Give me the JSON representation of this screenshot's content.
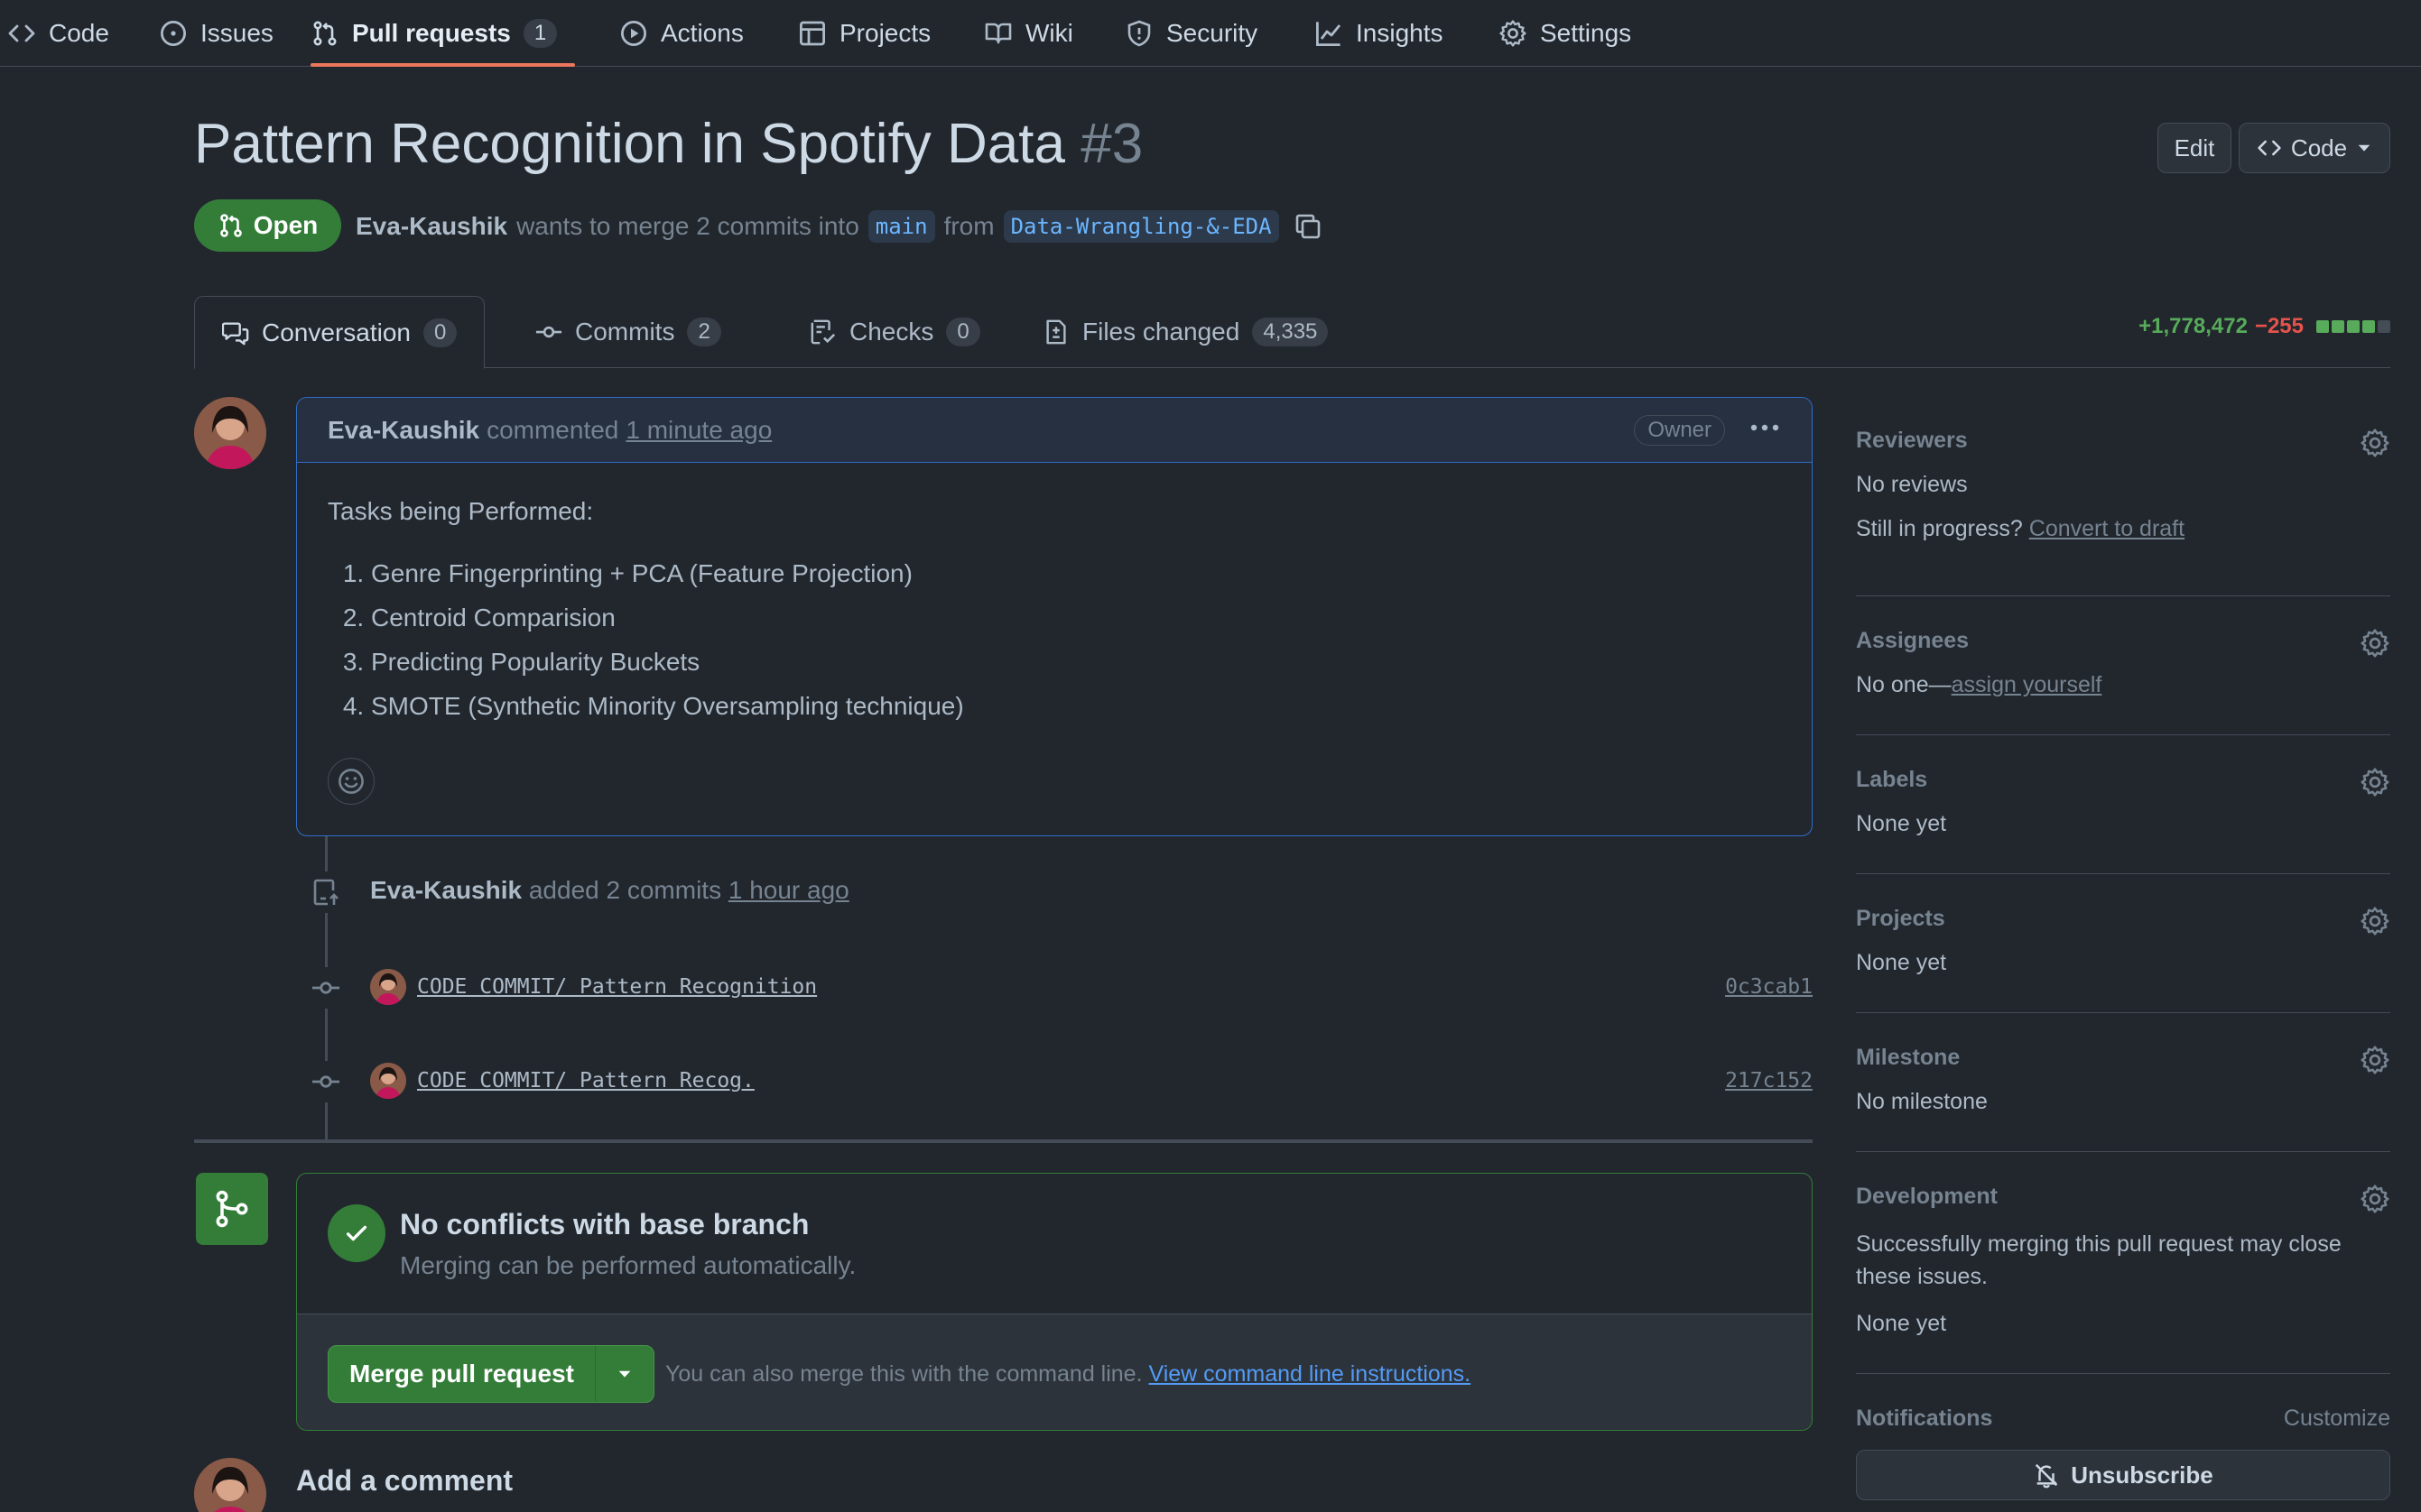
{
  "repo_nav": [
    {
      "label": "Code",
      "icon": "code-icon"
    },
    {
      "label": "Issues",
      "icon": "issue-opened-icon"
    },
    {
      "label": "Pull requests",
      "icon": "git-pull-request-icon",
      "count": "1",
      "active": true
    },
    {
      "label": "Actions",
      "icon": "play-icon"
    },
    {
      "label": "Projects",
      "icon": "table-icon"
    },
    {
      "label": "Wiki",
      "icon": "book-icon"
    },
    {
      "label": "Security",
      "icon": "shield-icon"
    },
    {
      "label": "Insights",
      "icon": "graph-icon"
    },
    {
      "label": "Settings",
      "icon": "gear-icon"
    }
  ],
  "header": {
    "title": "Pattern Recognition in Spotify Data",
    "number": "#3",
    "edit_label": "Edit",
    "code_label": "Code",
    "state": "Open",
    "author": "Eva-Kaushik",
    "merge_text": "wants to merge 2 commits into",
    "base_branch": "main",
    "from_text": "from",
    "head_branch": "Data-Wrangling-&-EDA"
  },
  "tabs": [
    {
      "label": "Conversation",
      "count": "0",
      "icon": "comment-discussion-icon"
    },
    {
      "label": "Commits",
      "count": "2",
      "icon": "git-commit-icon"
    },
    {
      "label": "Checks",
      "count": "0",
      "icon": "checklist-icon"
    },
    {
      "label": "Files changed",
      "count": "4,335",
      "icon": "file-diff-icon"
    }
  ],
  "diffstat": {
    "additions": "+1,778,472",
    "deletions": "−255",
    "green_color": "#57ab5a",
    "gray_color": "#444c56"
  },
  "comment": {
    "author": "Eva-Kaushik",
    "action": "commented",
    "time": "1 minute ago",
    "badge": "Owner",
    "intro": "Tasks being Performed:",
    "tasks": [
      "Genre Fingerprinting + PCA (Feature Projection)",
      "Centroid Comparision",
      "Predicting Popularity Buckets",
      "SMOTE (Synthetic Minority Oversampling technique)"
    ]
  },
  "timeline": {
    "push_author": "Eva-Kaushik",
    "push_text": "added 2 commits",
    "push_time": "1 hour ago",
    "commits": [
      {
        "message": "CODE COMMIT/ Pattern Recognition",
        "sha": "0c3cab1"
      },
      {
        "message": "CODE COMMIT/ Pattern Recog.",
        "sha": "217c152"
      }
    ]
  },
  "merge": {
    "title": "No conflicts with base branch",
    "subtitle": "Merging can be performed automatically.",
    "button_label": "Merge pull request",
    "hint": "You can also merge this with the command line.",
    "hint_link": "View command line instructions."
  },
  "add_comment_title": "Add a comment",
  "sidebar": {
    "reviewers": {
      "title": "Reviewers",
      "value": "No reviews",
      "draft_prefix": "Still in progress?",
      "draft_link": "Convert to draft"
    },
    "assignees": {
      "title": "Assignees",
      "prefix": "No one—",
      "link": "assign yourself"
    },
    "labels": {
      "title": "Labels",
      "value": "None yet"
    },
    "projects": {
      "title": "Projects",
      "value": "None yet"
    },
    "milestone": {
      "title": "Milestone",
      "value": "No milestone"
    },
    "development": {
      "title": "Development",
      "note": "Successfully merging this pull request may close these issues.",
      "value": "None yet"
    },
    "notifications": {
      "title": "Notifications",
      "customize": "Customize",
      "unsubscribe": "Unsubscribe"
    }
  }
}
